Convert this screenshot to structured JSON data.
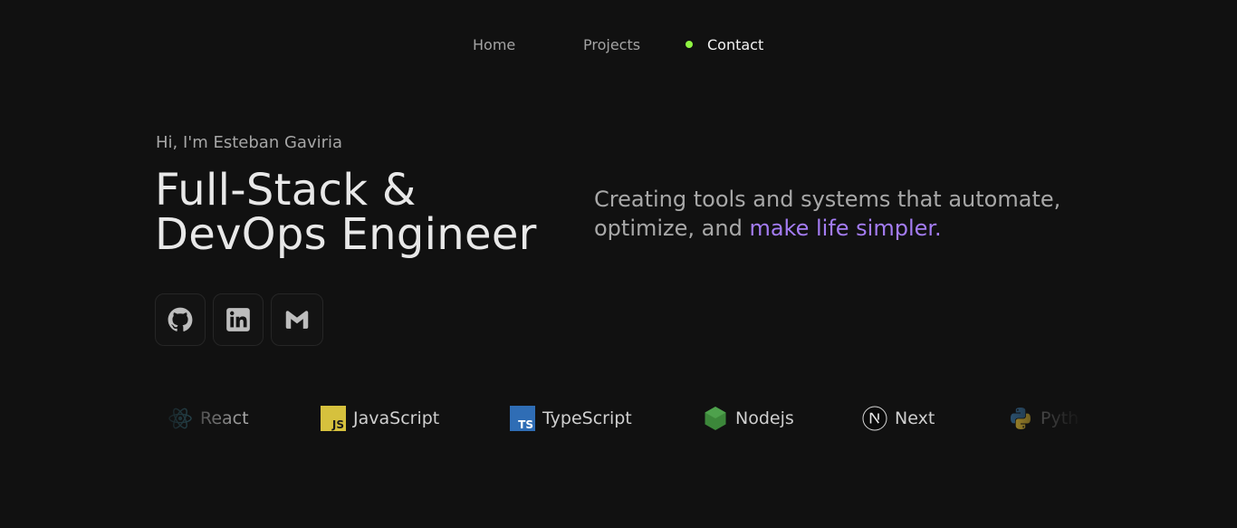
{
  "nav": {
    "items": [
      {
        "label": "Home"
      },
      {
        "label": "Projects"
      },
      {
        "label": "Contact"
      }
    ],
    "active_dot_color": "#8ff542"
  },
  "hero": {
    "greeting": "Hi, I'm Esteban Gaviria",
    "title_line1": "Full-Stack &",
    "title_line2": "DevOps Engineer",
    "tagline_prefix": "Creating tools and systems that automate, optimize, and ",
    "tagline_accent": "make life simpler.",
    "accent_color": "#a47cf3"
  },
  "social": [
    {
      "name": "github",
      "icon": "github-icon"
    },
    {
      "name": "linkedin",
      "icon": "linkedin-icon"
    },
    {
      "name": "gmail",
      "icon": "gmail-icon"
    }
  ],
  "tech": [
    {
      "label": "React",
      "icon": "react-icon"
    },
    {
      "label": "JavaScript",
      "icon": "javascript-icon"
    },
    {
      "label": "TypeScript",
      "icon": "typescript-icon"
    },
    {
      "label": "Nodejs",
      "icon": "nodejs-icon"
    },
    {
      "label": "Next",
      "icon": "nextjs-icon"
    },
    {
      "label": "Pyth",
      "icon": "python-icon"
    }
  ]
}
